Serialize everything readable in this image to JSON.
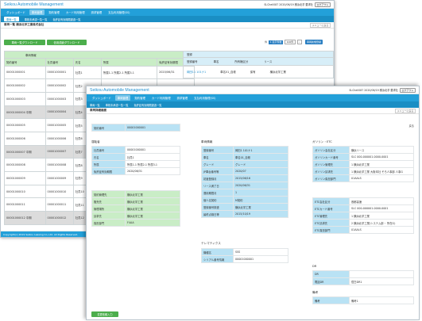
{
  "app": {
    "name": "Seikou Automobile Management",
    "user": "SLCheil087 2020/06/19 横浜北芋 要求社",
    "logout": "ログアウト"
  },
  "nav": [
    "ダッシュボード",
    "車両管理",
    "契約管理",
    "カード利用管理",
    "請求管理",
    "支払利用管理(SS)"
  ],
  "subnav": [
    "車両一覧",
    "車検未承認一覧一覧",
    "免許証有効期限超過一覧"
  ],
  "list_page": {
    "title": "車両一覧 横浜北芋工業株式会社",
    "menu": "メニューに戻る",
    "btn_list_download": "車両一覧ダウンロード",
    "btn_contract_download": "信用成績ダウンロード",
    "pager": {
      "prefix": "件",
      "label": "1 表示件数",
      "per": "100件",
      "next": "›"
    },
    "btn_new": "車両新規登録",
    "group_header": "車両情報",
    "group_header2": "登録",
    "columns": [
      "契約番号",
      "社員番号",
      "氏名",
      "所属",
      "免許証有効期限"
    ],
    "rows": [
      {
        "contract": "00001000001",
        "emp": "00001000001",
        "name": "社員1",
        "dept": "所属1-1 所属2-1 所属3-1",
        "exp": "2020/06/31",
        "gray": false
      },
      {
        "contract": "00001000002",
        "emp": "00001000002",
        "name": "社員2",
        "dept": "",
        "exp": "",
        "gray": false
      },
      {
        "contract": "00001000003",
        "emp": "00001000003",
        "name": "社員3",
        "dept": "",
        "exp": "",
        "gray": false
      },
      {
        "contract": "00001000004 中期",
        "emp": "00001000004",
        "name": "社員4",
        "dept": "",
        "exp": "",
        "gray": true
      },
      {
        "contract": "00001000005",
        "emp": "00001000005",
        "name": "社員5",
        "dept": "",
        "exp": "",
        "gray": false
      },
      {
        "contract": "00001000006",
        "emp": "00001000006",
        "name": "社員6",
        "dept": "",
        "exp": "",
        "gray": false
      },
      {
        "contract": "00001000007 中期",
        "emp": "00001000007",
        "name": "社員7",
        "dept": "",
        "exp": "",
        "gray": true
      },
      {
        "contract": "00001000008",
        "emp": "00001000008",
        "name": "社員8",
        "dept": "",
        "exp": "",
        "gray": false
      },
      {
        "contract": "00001000009",
        "emp": "00001000009",
        "name": "社員9",
        "dept": "",
        "exp": "",
        "gray": false
      },
      {
        "contract": "00001000010",
        "emp": "00001000010",
        "name": "社員10",
        "dept": "",
        "exp": "",
        "gray": false
      },
      {
        "contract": "00001000011",
        "emp": "00001000011",
        "name": "社員11",
        "dept": "",
        "exp": "",
        "gray": false
      },
      {
        "contract": "00001000012 中期",
        "emp": "00001000012",
        "name": "社員12",
        "dept": "",
        "exp": "",
        "gray": true
      }
    ],
    "right_columns": [
      "登録番号",
      "車名",
      "所有権区分",
      "リース"
    ],
    "right_row1": {
      "reg": "岡田11 101ナ1",
      "car": "車名01_自帳",
      "own": "保有",
      "lease": "横浜北芋工業"
    },
    "footer": "Copyright(c) 2019 Seikou Leasing Co.,Ltd. All Rights Reserved."
  },
  "detail_page": {
    "title": "車両詳細画面",
    "menu": "メニューに戻る",
    "back": "戻る",
    "contract_label": "契約番号",
    "contract_value": "00001000001",
    "driver_section": "運転者",
    "driver": [
      [
        "社員番号",
        "00001000001"
      ],
      [
        "氏名",
        "社員1"
      ],
      [
        "所属",
        "所属1-1 所属2-1 所属3-1"
      ],
      [
        "免許証有効期限",
        "2020/06/31"
      ]
    ],
    "contact": [
      [
        "契約管理先",
        "横浜北芋工業"
      ],
      [
        "販売先",
        "横浜北芋工業"
      ],
      [
        "管理場所",
        "横浜北芋工業"
      ],
      [
        "請求先",
        "横浜北芋工業"
      ],
      [
        "負担部門",
        "F4AA"
      ]
    ],
    "vehicle_section": "車両情報",
    "vehicle": [
      [
        "登録番号",
        "岡田1 101ナ1"
      ],
      [
        "車名",
        "車名01_自帳"
      ],
      [
        "グレード",
        "グレード"
      ],
      [
        "JP車台番号等",
        "2020/07"
      ],
      [
        "初度登録月",
        "2015/06/16"
      ],
      [
        "リース満了日",
        "2020/06/31"
      ],
      [
        "運用期間月",
        "1"
      ],
      [
        "個人名契約",
        "M契約"
      ],
      [
        "登録番号検査",
        "横浜北芋工業"
      ],
      [
        "最終点検日等",
        "2015/10/19"
      ]
    ],
    "telematics_section": "テレマティクス",
    "telematics": [
      [
        "機種名",
        "SSS"
      ],
      [
        "シリアル番号情報",
        "00001000001"
      ]
    ],
    "gas_section": "ガソリン・ETC",
    "gas": [
      [
        "ガソリン会社区分",
        "横浜リース"
      ],
      [
        "ガソリンカード番号",
        "SLC  000-000001-0000-0001"
      ],
      [
        "ガソリン管理先",
        "1   横浜北芋工業"
      ],
      [
        "ガソリン請求先",
        "1   横浜北芋工業 大阪本社 そろ人事部 人事G"
      ],
      [
        "ガソリン負担部門",
        "01AALS"
      ]
    ],
    "etc": [
      [
        "ETC会社区分",
        "首都高速"
      ],
      [
        "ETCカード番号",
        "SLC  000-000001-0000-0001"
      ],
      [
        "ETC管理先",
        "1   横浜北芋工業"
      ],
      [
        "ETC請求先",
        "2   横浜北芋工業(システム部・ 所在G)"
      ],
      [
        "ETC負担部門",
        "01AALS"
      ]
    ],
    "dr_section": "DR",
    "dr": [
      [
        "DR",
        ""
      ],
      [
        "電話DR",
        "億白DR1"
      ]
    ],
    "remarks_section": "備考",
    "remarks": [
      [
        "備考",
        "備考1"
      ]
    ],
    "save": "変更依頼入力"
  }
}
